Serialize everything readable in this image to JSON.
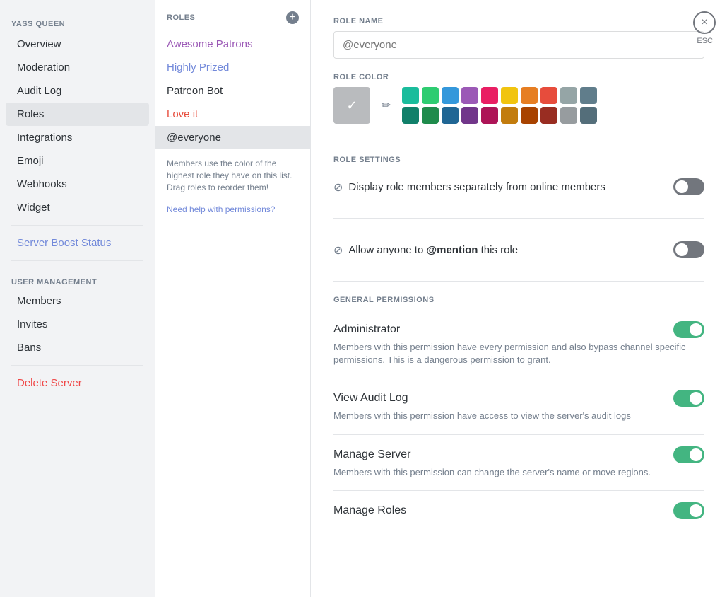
{
  "sidebar": {
    "server_name": "YASS QUEEN",
    "items": [
      {
        "label": "Overview",
        "id": "overview",
        "active": false,
        "danger": false
      },
      {
        "label": "Moderation",
        "id": "moderation",
        "active": false,
        "danger": false
      },
      {
        "label": "Audit Log",
        "id": "audit-log",
        "active": false,
        "danger": false
      },
      {
        "label": "Roles",
        "id": "roles",
        "active": true,
        "danger": false
      },
      {
        "label": "Integrations",
        "id": "integrations",
        "active": false,
        "danger": false
      },
      {
        "label": "Emoji",
        "id": "emoji",
        "active": false,
        "danger": false
      },
      {
        "label": "Webhooks",
        "id": "webhooks",
        "active": false,
        "danger": false
      },
      {
        "label": "Widget",
        "id": "widget",
        "active": false,
        "danger": false
      }
    ],
    "boost_status": "Server Boost Status",
    "user_management_label": "USER MANAGEMENT",
    "user_management_items": [
      {
        "label": "Members"
      },
      {
        "label": "Invites"
      },
      {
        "label": "Bans"
      }
    ],
    "delete_server": "Delete Server"
  },
  "roles_panel": {
    "title": "ROLES",
    "roles": [
      {
        "label": "Awesome Patrons",
        "color": "purple"
      },
      {
        "label": "Highly Prized",
        "color": "blue"
      },
      {
        "label": "Patreon Bot",
        "color": "default"
      },
      {
        "label": "Love it",
        "color": "red"
      },
      {
        "label": "@everyone",
        "color": "default",
        "selected": true
      }
    ],
    "info_text": "Members use the color of the highest role they have on this list. Drag roles to reorder them!",
    "help_link": "Need help with permissions?"
  },
  "main": {
    "role_name_label": "ROLE NAME",
    "role_name_placeholder": "@everyone",
    "role_color_label": "ROLE COLOR",
    "close_label": "×",
    "esc_label": "ESC",
    "role_settings_label": "ROLE SETTINGS",
    "display_role_label": "Display role members separately from online members",
    "allow_mention_label": "Allow anyone to @mention this role",
    "general_permissions_label": "GENERAL PERMISSIONS",
    "permissions": [
      {
        "name": "Administrator",
        "desc": "Members with this permission have every permission and also bypass channel specific permissions. This is a dangerous permission to grant.",
        "on": true
      },
      {
        "name": "View Audit Log",
        "desc": "Members with this permission have access to view the server's audit logs",
        "on": true
      },
      {
        "name": "Manage Server",
        "desc": "Members with this permission can change the server's name or move regions.",
        "on": true
      },
      {
        "name": "Manage Roles",
        "desc": "",
        "on": true
      }
    ],
    "colors_row1": [
      {
        "hex": "#1abc9c"
      },
      {
        "hex": "#2ecc71"
      },
      {
        "hex": "#3498db"
      },
      {
        "hex": "#9b59b6"
      },
      {
        "hex": "#e91e63"
      },
      {
        "hex": "#f1c40f"
      },
      {
        "hex": "#e67e22"
      },
      {
        "hex": "#e74c3c"
      },
      {
        "hex": "#95a5a6"
      },
      {
        "hex": "#607d8b"
      }
    ],
    "colors_row2": [
      {
        "hex": "#11806a"
      },
      {
        "hex": "#1f8b4c"
      },
      {
        "hex": "#206694"
      },
      {
        "hex": "#71368a"
      },
      {
        "hex": "#ad1457"
      },
      {
        "hex": "#c27c0e"
      },
      {
        "hex": "#a84300"
      },
      {
        "hex": "#992d22"
      },
      {
        "hex": "#979c9f"
      },
      {
        "hex": "#546e7a"
      }
    ]
  }
}
